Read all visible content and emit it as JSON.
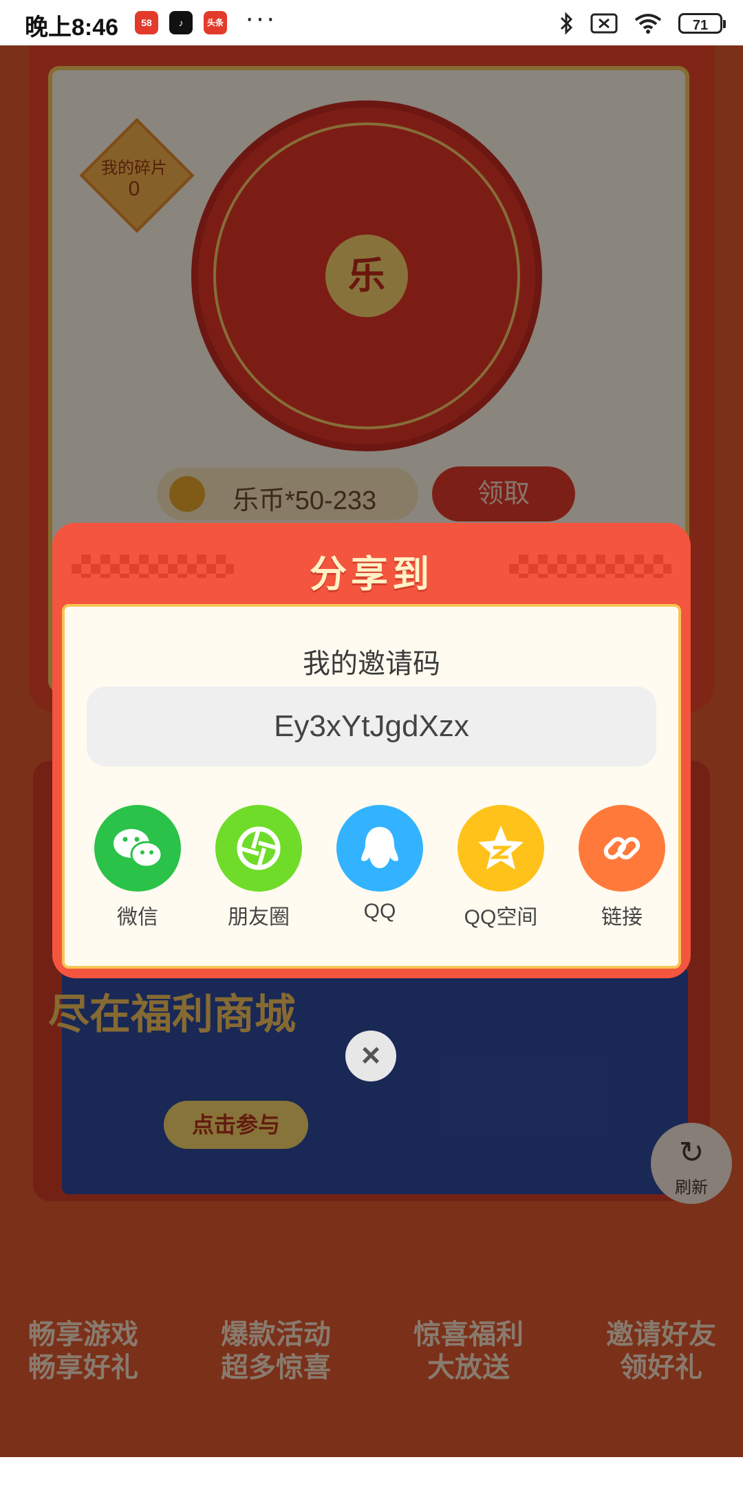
{
  "status_bar": {
    "time": "晚上8:46",
    "apps": [
      {
        "name": "58-app-icon",
        "label": "58",
        "color": "#e23b2b"
      },
      {
        "name": "tiktok-app-icon",
        "label": "♪",
        "color": "#111111"
      },
      {
        "name": "news-app-icon",
        "label": "头条",
        "color": "#e23b2b"
      }
    ],
    "more": "···",
    "battery": "71"
  },
  "background": {
    "fragment_label": "我的碎片",
    "fragment_count": "0",
    "wheel_center": "乐",
    "coin_reward": "乐币*50-233",
    "claim_button": "领取",
    "promo_line": "尽在福利商城",
    "promo_button": "点击参与",
    "refresh_label": "刷新",
    "features": [
      {
        "line1": "畅享游戏",
        "line2": "畅享好礼"
      },
      {
        "line1": "爆款活动",
        "line2": "超多惊喜"
      },
      {
        "line1": "惊喜福利",
        "line2": "大放送"
      },
      {
        "line1": "邀请好友",
        "line2": "领好礼"
      }
    ]
  },
  "dialog": {
    "title": "分享到",
    "invite_label": "我的邀请码",
    "invite_code": "Ey3xYtJgdXzx",
    "share_targets": [
      {
        "label": "微信",
        "icon": "wechat-icon",
        "color": "#2bc24a"
      },
      {
        "label": "朋友圈",
        "icon": "moments-icon",
        "color": "#6fdc2a"
      },
      {
        "label": "QQ",
        "icon": "qq-icon",
        "color": "#33b3ff"
      },
      {
        "label": "QQ空间",
        "icon": "qzone-icon",
        "color": "#ffc21a"
      },
      {
        "label": "链接",
        "icon": "link-icon",
        "color": "#ff7a3a"
      }
    ],
    "close": "×"
  }
}
